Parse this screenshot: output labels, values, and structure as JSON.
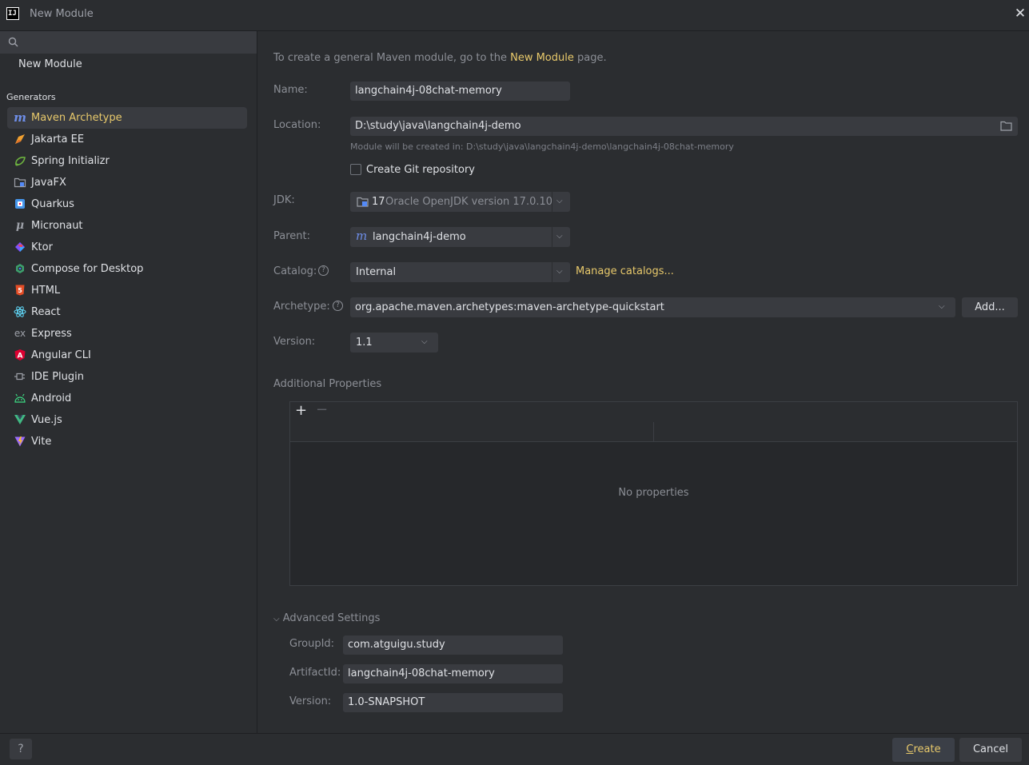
{
  "window": {
    "logo_text": "IJ",
    "title": "New Module"
  },
  "sidebar": {
    "search": {
      "placeholder": "",
      "value": ""
    },
    "top_item": "New Module",
    "generators_label": "Generators",
    "generators": [
      {
        "label": "Maven Archetype",
        "icon": "maven-icon",
        "selected": true
      },
      {
        "label": "Jakarta EE",
        "icon": "jakarta-icon"
      },
      {
        "label": "Spring Initializr",
        "icon": "spring-icon"
      },
      {
        "label": "JavaFX",
        "icon": "javafx-icon"
      },
      {
        "label": "Quarkus",
        "icon": "quarkus-icon"
      },
      {
        "label": "Micronaut",
        "icon": "micronaut-icon"
      },
      {
        "label": "Ktor",
        "icon": "ktor-icon"
      },
      {
        "label": "Compose for Desktop",
        "icon": "compose-icon"
      },
      {
        "label": "HTML",
        "icon": "html5-icon"
      },
      {
        "label": "React",
        "icon": "react-icon"
      },
      {
        "label": "Express",
        "icon": "express-icon"
      },
      {
        "label": "Angular CLI",
        "icon": "angular-icon"
      },
      {
        "label": "IDE Plugin",
        "icon": "plugin-icon"
      },
      {
        "label": "Android",
        "icon": "android-icon"
      },
      {
        "label": "Vue.js",
        "icon": "vue-icon"
      },
      {
        "label": "Vite",
        "icon": "vite-icon"
      }
    ]
  },
  "form": {
    "intro_prefix": "To create a general Maven module, go to the",
    "intro_link": "New Module",
    "intro_suffix": "page.",
    "name_label": "Name:",
    "name_value": "langchain4j-08chat-memory",
    "location_label": "Location:",
    "location_value": "D:\\study\\java\\langchain4j-demo",
    "location_hint": "Module will be created in: D:\\study\\java\\langchain4j-demo\\langchain4j-08chat-memory",
    "git_label": "Create Git repository",
    "git_checked": false,
    "jdk_label": "JDK:",
    "jdk_version": "17",
    "jdk_name": "Oracle OpenJDK version 17.0.10",
    "parent_label": "Parent:",
    "parent_value": "langchain4j-demo",
    "catalog_label": "Catalog:",
    "catalog_value": "Internal",
    "manage_catalogs": "Manage catalogs...",
    "archetype_label": "Archetype:",
    "archetype_value": "org.apache.maven.archetypes:maven-archetype-quickstart",
    "add_button": "Add...",
    "version_label": "Version:",
    "version_value": "1.1",
    "additional_properties": "Additional Properties",
    "no_properties": "No properties",
    "advanced_settings": "Advanced Settings",
    "groupid_label": "GroupId:",
    "groupid_value": "com.atguigu.study",
    "artifactid_label": "ArtifactId:",
    "artifactid_value": "langchain4j-08chat-memory",
    "adv_version_label": "Version:",
    "adv_version_value": "1.0-SNAPSHOT"
  },
  "footer": {
    "help": "?",
    "create_mnemonic": "C",
    "create_rest": "reate",
    "cancel": "Cancel"
  },
  "colors": {
    "accent_link": "#e8c96b",
    "selected_bg": "#393b40",
    "field_bg": "#393b40",
    "panel_bg": "#2b2d30"
  }
}
